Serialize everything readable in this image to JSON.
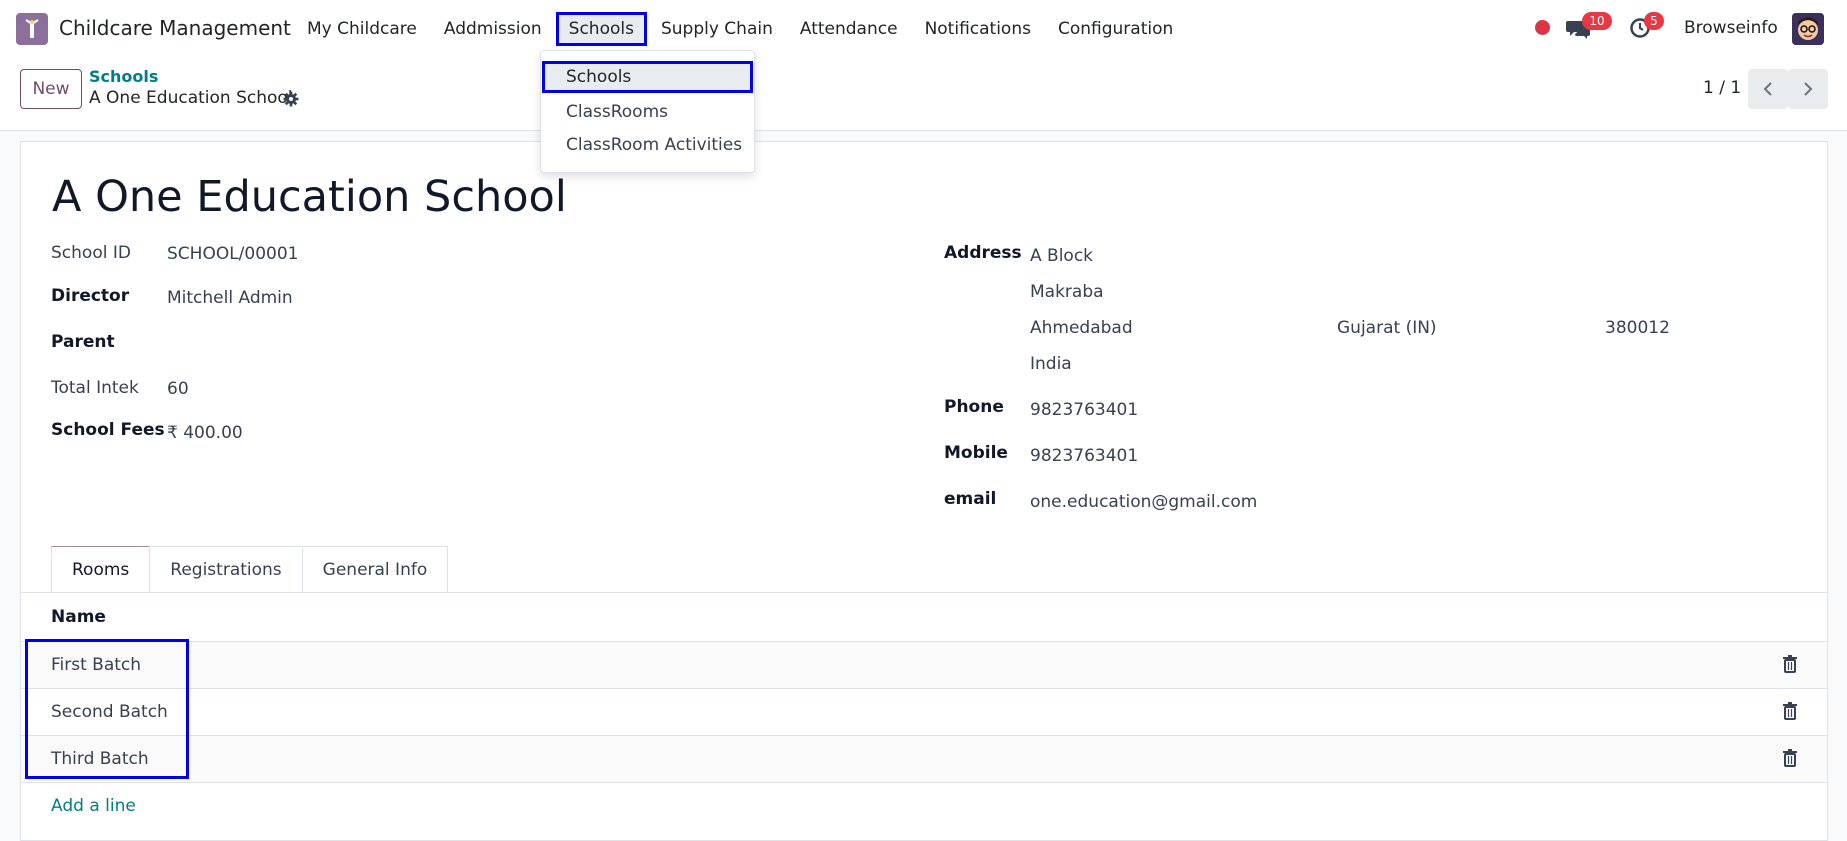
{
  "navbar": {
    "app_name": "Childcare Management",
    "menu": [
      {
        "label": "My Childcare"
      },
      {
        "label": "Addmission"
      },
      {
        "label": "Schools"
      },
      {
        "label": "Supply Chain"
      },
      {
        "label": "Attendance"
      },
      {
        "label": "Notifications"
      },
      {
        "label": "Configuration"
      }
    ],
    "messages_count": "10",
    "activities_count": "5",
    "user_name": "Browseinfo",
    "icons": [
      "app-logo-icon",
      "chat-icon",
      "clock-icon",
      "avatar"
    ]
  },
  "dropdown": {
    "items": [
      {
        "label": "Schools"
      },
      {
        "label": "ClassRooms"
      },
      {
        "label": "ClassRoom Activities"
      }
    ]
  },
  "control_panel": {
    "new_label": "New",
    "breadcrumb": "Schools",
    "record_name": "A One Education School",
    "pager": "1 / 1"
  },
  "form": {
    "title": "A One Education School",
    "left": {
      "school_id_label": "School ID",
      "school_id": "SCHOOL/00001",
      "director_label": "Director",
      "director": "Mitchell Admin",
      "parent_label": "Parent",
      "total_intek_label": "Total Intek",
      "total_intek": "60",
      "school_fees_label": "School Fees",
      "school_fees": "₹ 400.00"
    },
    "right": {
      "address_label": "Address",
      "street": "A Block",
      "street2": "Makraba",
      "city": "Ahmedabad",
      "state": "Gujarat (IN)",
      "zip": "380012",
      "country": "India",
      "phone_label": "Phone",
      "phone": "9823763401",
      "mobile_label": "Mobile",
      "mobile": "9823763401",
      "email_label": "email",
      "email": "one.education@gmail.com"
    },
    "tabs": [
      {
        "label": "Rooms"
      },
      {
        "label": "Registrations"
      },
      {
        "label": "General Info"
      }
    ],
    "rooms_header": "Name",
    "rooms": [
      {
        "name": "First Batch"
      },
      {
        "name": "Second Batch"
      },
      {
        "name": "Third Batch"
      }
    ],
    "add_line": "Add a line"
  },
  "colors": {
    "brand": "#714b67",
    "link": "#017e84",
    "badge": "#e63946",
    "highlight": "#0000ee"
  }
}
